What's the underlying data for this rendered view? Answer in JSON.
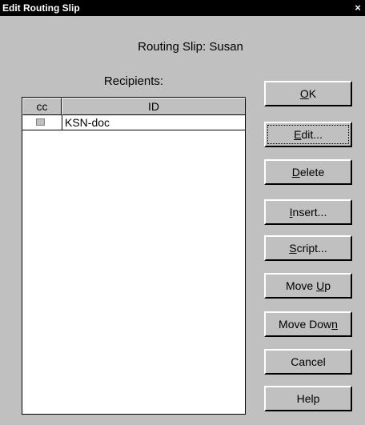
{
  "window": {
    "title": "Edit Routing Slip",
    "close_glyph": "×"
  },
  "heading": "Routing Slip: Susan",
  "recipients_label": "Recipients:",
  "list": {
    "columns": [
      "cc",
      "ID"
    ],
    "rows": [
      {
        "cc": false,
        "id": "KSN-doc"
      }
    ]
  },
  "buttons": {
    "ok": {
      "pre": "",
      "key": "O",
      "post": "K"
    },
    "edit": {
      "pre": "",
      "key": "E",
      "post": "dit..."
    },
    "delete": {
      "pre": "",
      "key": "D",
      "post": "elete"
    },
    "insert": {
      "pre": "",
      "key": "I",
      "post": "nsert..."
    },
    "script": {
      "pre": "",
      "key": "S",
      "post": "cript..."
    },
    "move_up": {
      "pre": "Move ",
      "key": "U",
      "post": "p"
    },
    "move_down": {
      "pre": "Move Dow",
      "key": "n",
      "post": ""
    },
    "cancel": {
      "pre": "Cancel",
      "key": "",
      "post": ""
    },
    "help": {
      "pre": "Help",
      "key": "",
      "post": ""
    }
  },
  "colors": {
    "title_bg": "#000000",
    "dialog_bg": "#c0c0c0",
    "list_bg": "#ffffff"
  }
}
